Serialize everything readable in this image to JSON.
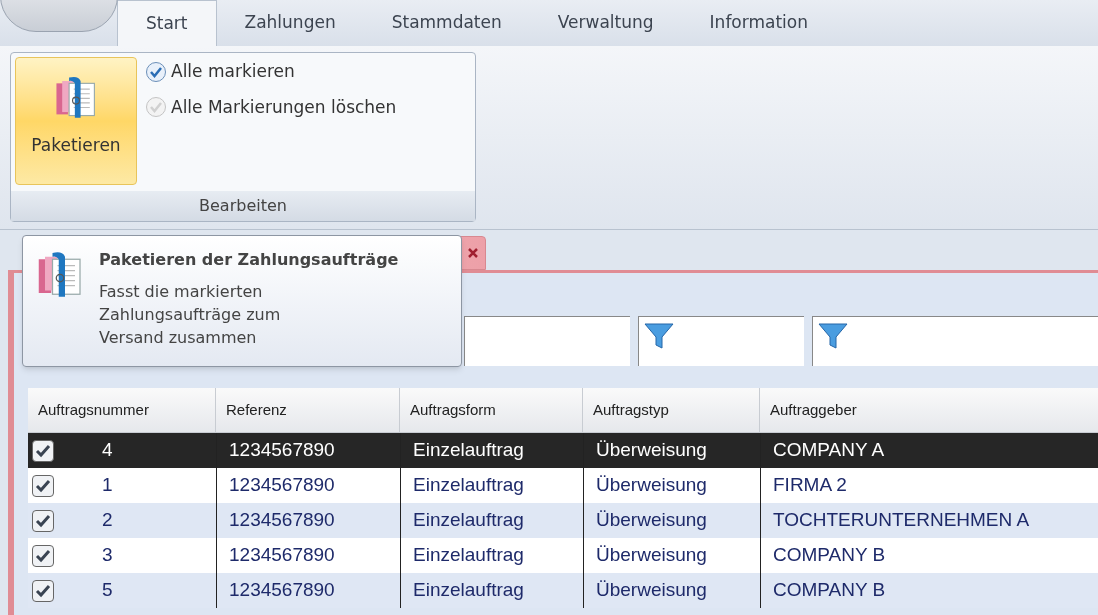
{
  "ribbon": {
    "tabs": [
      {
        "label": "Start",
        "selected": true
      },
      {
        "label": "Zahlungen",
        "selected": false
      },
      {
        "label": "Stammdaten",
        "selected": false
      },
      {
        "label": "Verwaltung",
        "selected": false
      },
      {
        "label": "Information",
        "selected": false
      }
    ],
    "group": {
      "label": "Bearbeiten",
      "big_button": "Paketieren",
      "commands": [
        {
          "label": "Alle markieren",
          "kind": "active"
        },
        {
          "label": "Alle Markierungen löschen",
          "kind": "inactive"
        }
      ]
    }
  },
  "tooltip": {
    "title": "Paketieren der Zahlungsaufträge",
    "text": "Fasst die markierten Zahlungsaufträge zum Versand zusammen"
  },
  "filters": [
    {
      "kind": "plain"
    },
    {
      "kind": "funnel"
    },
    {
      "kind": "funnel"
    }
  ],
  "table": {
    "columns": [
      "Auftragsnummer",
      "Referenz",
      "Auftragsform",
      "Auftragstyp",
      "Auftraggeber"
    ],
    "rows": [
      {
        "checked": true,
        "selected": true,
        "cells": [
          "4",
          "1234567890",
          "Einzelauftrag",
          "Überweisung",
          "COMPANY A"
        ]
      },
      {
        "checked": true,
        "selected": false,
        "cells": [
          "1",
          "1234567890",
          "Einzelauftrag",
          "Überweisung",
          "FIRMA 2"
        ]
      },
      {
        "checked": true,
        "selected": false,
        "cells": [
          "2",
          "1234567890",
          "Einzelauftrag",
          "Überweisung",
          "TOCHTERUNTERNEHMEN A"
        ]
      },
      {
        "checked": true,
        "selected": false,
        "cells": [
          "3",
          "1234567890",
          "Einzelauftrag",
          "Überweisung",
          "COMPANY B"
        ]
      },
      {
        "checked": true,
        "selected": false,
        "cells": [
          "5",
          "1234567890",
          "Einzelauftrag",
          "Überweisung",
          "COMPANY B"
        ]
      }
    ]
  }
}
